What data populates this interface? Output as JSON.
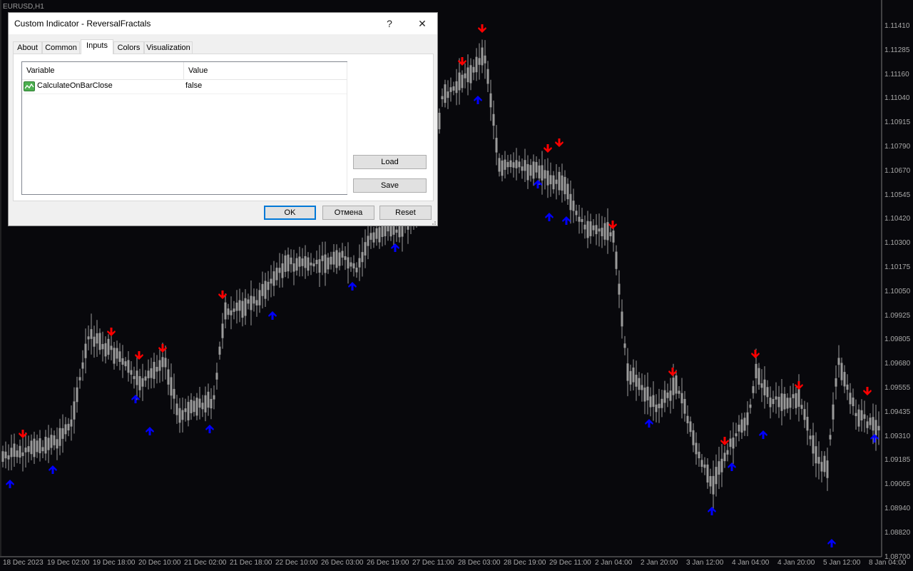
{
  "chart": {
    "symbol": "EURUSD,H1",
    "price_labels": [
      "1.11410",
      "1.11285",
      "1.11160",
      "1.11040",
      "1.10915",
      "1.10790",
      "1.10670",
      "1.10545",
      "1.10420",
      "1.10300",
      "1.10175",
      "1.10050",
      "1.09925",
      "1.09805",
      "1.09680",
      "1.09555",
      "1.09435",
      "1.09310",
      "1.09185",
      "1.09065",
      "1.08940",
      "1.08820",
      "1.08700"
    ],
    "time_labels": [
      "18 Dec 2023",
      "19 Dec 02:00",
      "19 Dec 18:00",
      "20 Dec 10:00",
      "21 Dec 02:00",
      "21 Dec 18:00",
      "22 Dec 10:00",
      "26 Dec 03:00",
      "26 Dec 19:00",
      "27 Dec 11:00",
      "28 Dec 03:00",
      "28 Dec 19:00",
      "29 Dec 11:00",
      "2 Jan 04:00",
      "2 Jan 20:00",
      "3 Jan 12:00",
      "4 Jan 04:00",
      "4 Jan 20:00",
      "5 Jan 12:00",
      "8 Jan 04:00"
    ],
    "colors": {
      "background": "#08080c",
      "candle": "#9b9b9b",
      "fractal_up": "#ff0000",
      "fractal_down": "#0000ff"
    }
  },
  "dialog": {
    "title": "Custom Indicator - ReversalFractals",
    "help_label": "?",
    "close_label": "✕",
    "tabs": [
      {
        "label": "About"
      },
      {
        "label": "Common"
      },
      {
        "label": "Inputs"
      },
      {
        "label": "Colors"
      },
      {
        "label": "Visualization"
      }
    ],
    "active_tab": "Inputs",
    "grid": {
      "columns": [
        "Variable",
        "Value"
      ],
      "rows": [
        {
          "icon": "boolean-param-icon",
          "name": "CalculateOnBarClose",
          "value": "false"
        }
      ]
    },
    "buttons": {
      "load": "Load",
      "save": "Save",
      "ok": "OK",
      "cancel": "Отмена",
      "reset": "Reset"
    }
  }
}
